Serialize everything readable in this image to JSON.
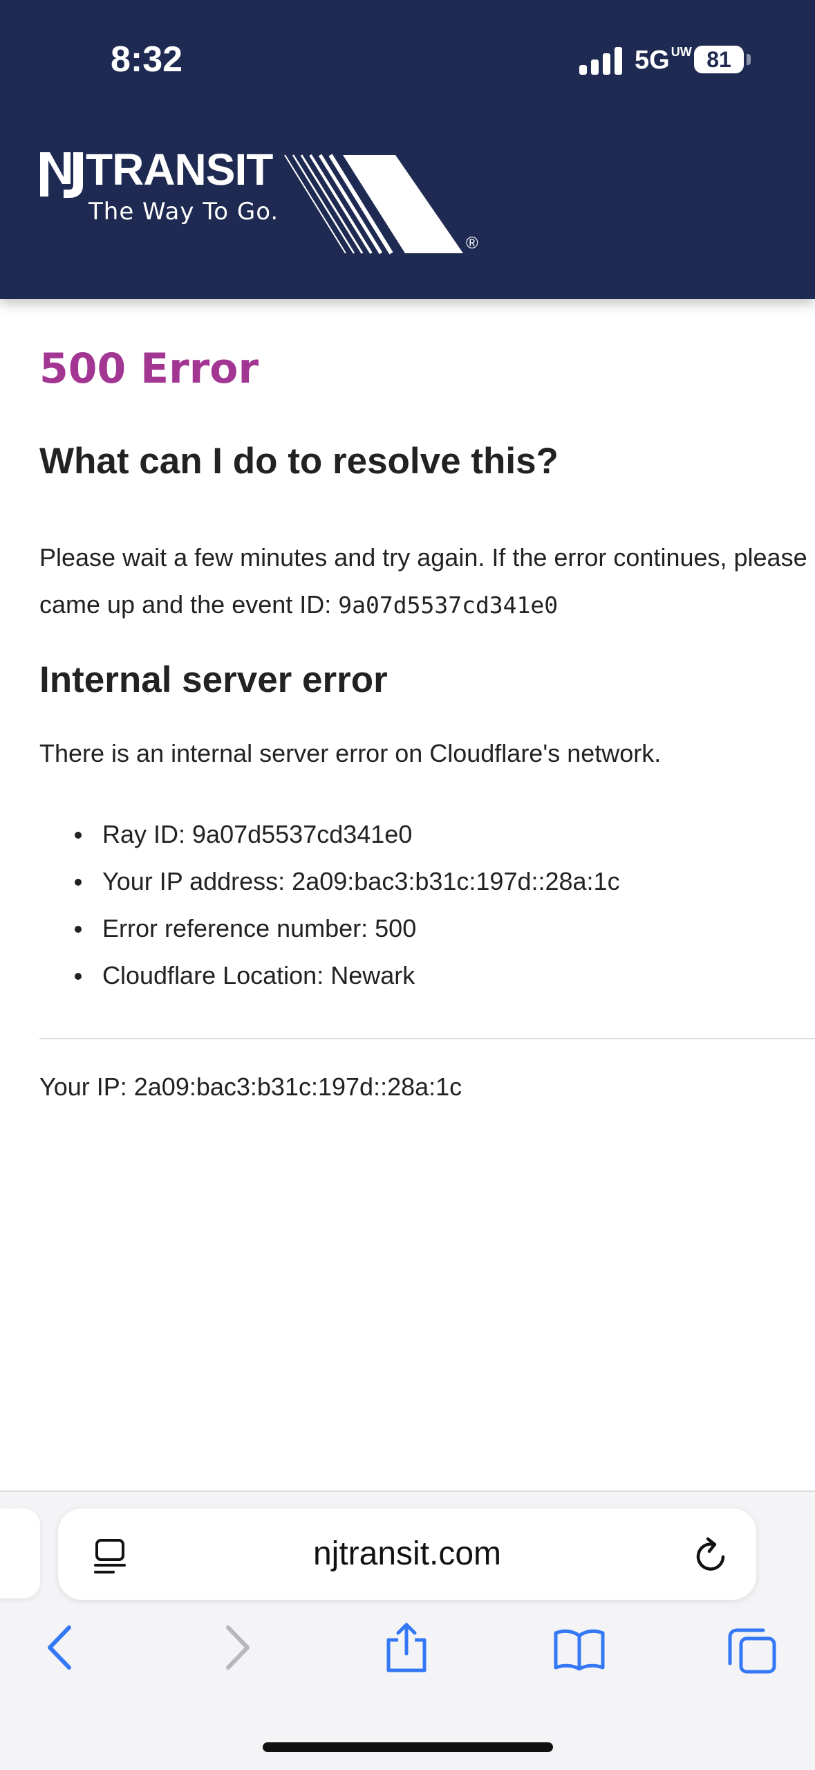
{
  "status_bar": {
    "time": "8:32",
    "network": "5G",
    "network_suffix": "UW",
    "battery": "81"
  },
  "header": {
    "logo_wordmark": "TRANSIT",
    "logo_tagline": "The Way To Go.",
    "registered": "®",
    "colors": {
      "background": "#1f2a52",
      "text": "#ffffff"
    }
  },
  "content": {
    "error_title": "500 Error",
    "resolve_heading": "What can I do to resolve this?",
    "resolve_line1": "Please wait a few minutes and try again. If the error continues, please",
    "resolve_line2_prefix": "came up and the event ID: ",
    "event_id": "9a07d5537cd341e0",
    "server_heading": "Internal server error",
    "server_description": "There is an internal server error on Cloudflare's network.",
    "details": [
      "Ray ID: 9a07d5537cd341e0",
      "Your IP address: 2a09:bac3:b31c:197d::28a:1c",
      "Error reference number: 500",
      "Cloudflare Location: Newark"
    ],
    "footer_ip": "Your IP: 2a09:bac3:b31c:197d::28a:1c",
    "accent_color": "#a33693"
  },
  "browser": {
    "url": "njtransit.com",
    "icons": [
      "reader-icon",
      "reload-icon",
      "back-icon",
      "forward-icon",
      "share-icon",
      "bookmarks-icon",
      "tabs-icon"
    ],
    "accent_color": "#3478f6"
  }
}
